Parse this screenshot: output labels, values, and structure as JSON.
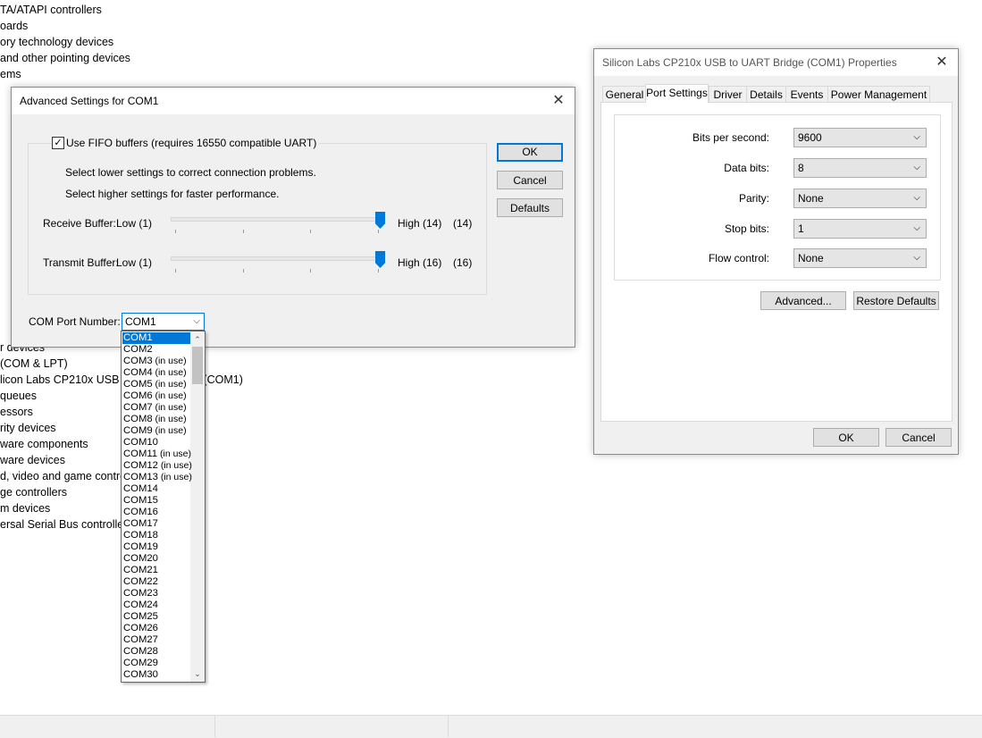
{
  "background_tree": [
    "TA/ATAPI controllers",
    "oards",
    "ory technology devices",
    " and other pointing devices",
    "ems",
    "r devices",
    " (COM & LPT)",
    "licon Labs CP210x USB to UART Bridge (COM1)",
    "queues",
    "essors",
    "rity devices",
    "ware components",
    "ware devices",
    "d, video and game controllers",
    "ge controllers",
    "m devices",
    "ersal Serial Bus controllers"
  ],
  "advanced": {
    "title": "Advanced Settings for COM1",
    "fifo_label": "Use FIFO buffers (requires 16550 compatible UART)",
    "fifo_checked": "✓",
    "hint1": "Select lower settings to correct connection problems.",
    "hint2": "Select higher settings for faster performance.",
    "receive": {
      "label": "Receive Buffer:",
      "low": "Low (1)",
      "high": "High (14)",
      "value": "(14)",
      "level_fraction": 1.0
    },
    "transmit": {
      "label": "Transmit Buffer:",
      "low": "Low (1)",
      "high": "High (16)",
      "value": "(16)",
      "level_fraction": 1.0
    },
    "com_label": "COM Port Number:",
    "com_value": "COM1",
    "ok": "OK",
    "cancel": "Cancel",
    "defaults": "Defaults",
    "com_options": [
      {
        "name": "COM1",
        "tag": ""
      },
      {
        "name": "COM2",
        "tag": ""
      },
      {
        "name": "COM3",
        "tag": " (in use)"
      },
      {
        "name": "COM4",
        "tag": " (in use)"
      },
      {
        "name": "COM5",
        "tag": " (in use)"
      },
      {
        "name": "COM6",
        "tag": " (in use)"
      },
      {
        "name": "COM7",
        "tag": " (in use)"
      },
      {
        "name": "COM8",
        "tag": " (in use)"
      },
      {
        "name": "COM9",
        "tag": " (in use)"
      },
      {
        "name": "COM10",
        "tag": ""
      },
      {
        "name": "COM11",
        "tag": " (in use)"
      },
      {
        "name": "COM12",
        "tag": " (in use)"
      },
      {
        "name": "COM13",
        "tag": " (in use)"
      },
      {
        "name": "COM14",
        "tag": ""
      },
      {
        "name": "COM15",
        "tag": ""
      },
      {
        "name": "COM16",
        "tag": ""
      },
      {
        "name": "COM17",
        "tag": ""
      },
      {
        "name": "COM18",
        "tag": ""
      },
      {
        "name": "COM19",
        "tag": ""
      },
      {
        "name": "COM20",
        "tag": ""
      },
      {
        "name": "COM21",
        "tag": ""
      },
      {
        "name": "COM22",
        "tag": ""
      },
      {
        "name": "COM23",
        "tag": ""
      },
      {
        "name": "COM24",
        "tag": ""
      },
      {
        "name": "COM25",
        "tag": ""
      },
      {
        "name": "COM26",
        "tag": ""
      },
      {
        "name": "COM27",
        "tag": ""
      },
      {
        "name": "COM28",
        "tag": ""
      },
      {
        "name": "COM29",
        "tag": ""
      },
      {
        "name": "COM30",
        "tag": ""
      }
    ]
  },
  "properties": {
    "title": "Silicon Labs CP210x USB to UART Bridge (COM1) Properties",
    "tabs": [
      "General",
      "Port Settings",
      "Driver",
      "Details",
      "Events",
      "Power Management"
    ],
    "active_tab": "Port Settings",
    "fields": [
      {
        "label": "Bits per second:",
        "value": "9600"
      },
      {
        "label": "Data bits:",
        "value": "8"
      },
      {
        "label": "Parity:",
        "value": "None"
      },
      {
        "label": "Stop bits:",
        "value": "1"
      },
      {
        "label": "Flow control:",
        "value": "None"
      }
    ],
    "advanced_btn": "Advanced...",
    "restore_btn": "Restore Defaults",
    "ok": "OK",
    "cancel": "Cancel"
  },
  "icons": {
    "close": "close-icon",
    "dropdown": "chevron-down-icon",
    "scroll_up": "chevron-up-icon"
  }
}
